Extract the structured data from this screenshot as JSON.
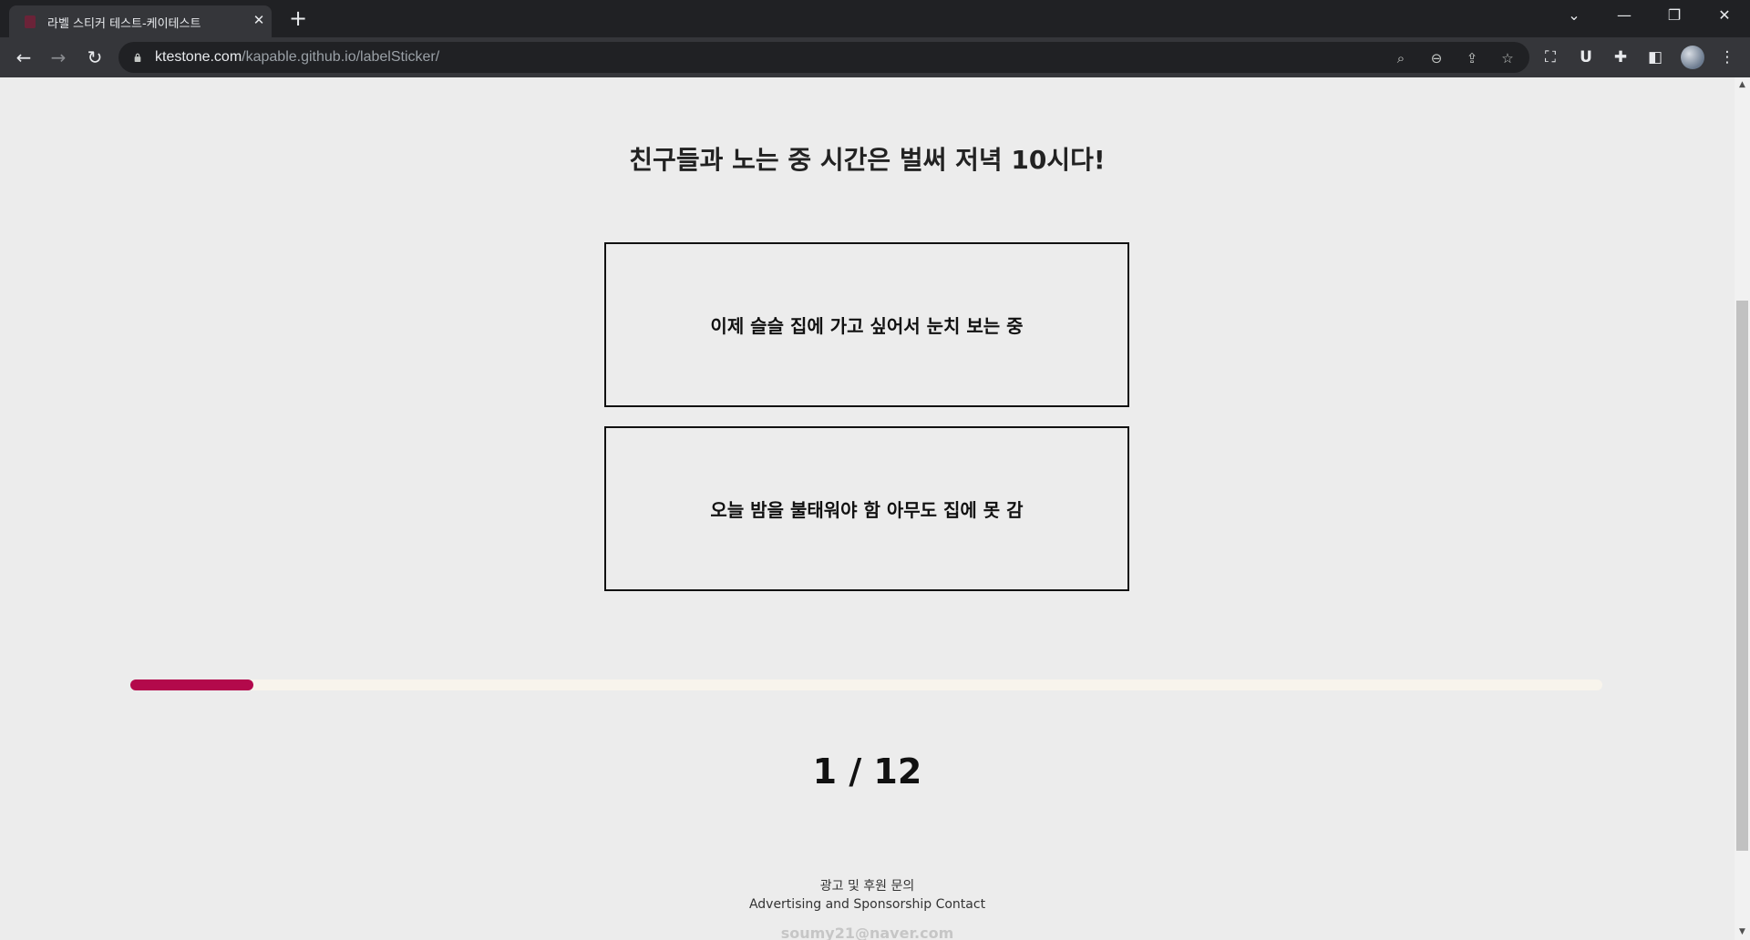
{
  "browser": {
    "tab_title": "라벨 스티커 테스트-케이테스트",
    "url_host": "ktestone.com",
    "url_path": "/kapable.github.io/labelSticker/"
  },
  "quiz": {
    "question": "친구들과 노는 중 시간은 벌써 저녁 10시다!",
    "answers": [
      "이제 슬슬 집에 가고 싶어서 눈치 보는 중",
      "오늘 밤을 불태워야 함 아무도 집에 못 감"
    ],
    "progress": {
      "current": 1,
      "total": 12,
      "counter_text": "1 / 12",
      "color": "#b3094b"
    }
  },
  "footer": {
    "contact_ko": "광고 및 후원 문의",
    "contact_en": "Advertising and Sponsorship Contact",
    "email": "soumy21@naver.com"
  }
}
